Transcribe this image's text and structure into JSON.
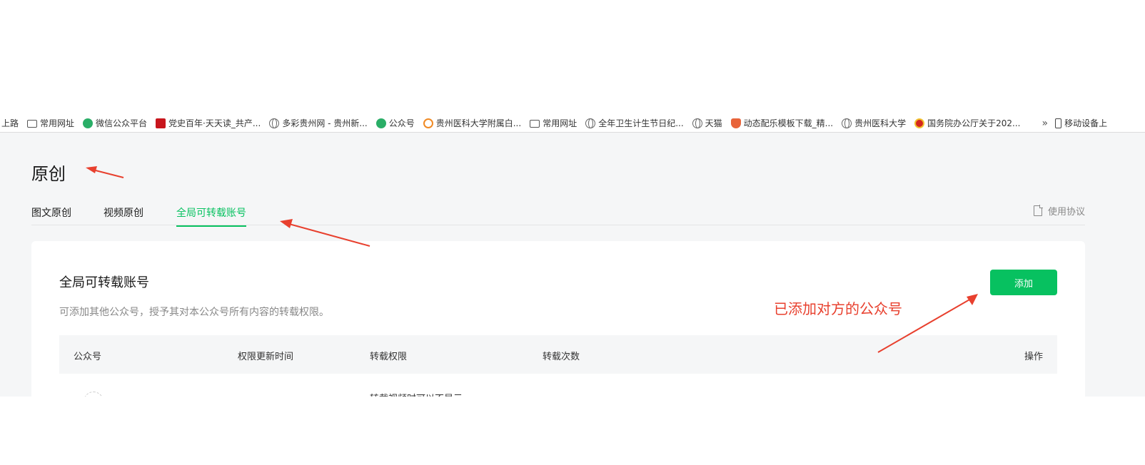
{
  "bookmarks": {
    "items": [
      {
        "label": "上路",
        "icon": "none"
      },
      {
        "label": "常用网址",
        "icon": "folder-icon"
      },
      {
        "label": "微信公众平台",
        "icon": "wechat-icon"
      },
      {
        "label": "党史百年·天天读_共产...",
        "icon": "party-icon"
      },
      {
        "label": "多彩贵州网 - 贵州新...",
        "icon": "globe-icon"
      },
      {
        "label": "公众号",
        "icon": "wechat-icon"
      },
      {
        "label": "贵州医科大学附属白...",
        "icon": "play-circle-icon"
      },
      {
        "label": "常用网址",
        "icon": "folder-icon"
      },
      {
        "label": "全年卫生计生节日纪...",
        "icon": "globe-icon"
      },
      {
        "label": "天猫",
        "icon": "globe-icon"
      },
      {
        "label": "动态配乐模板下载_精...",
        "icon": "fox-icon"
      },
      {
        "label": "贵州医科大学",
        "icon": "globe-icon"
      },
      {
        "label": "国务院办公厅关于202...",
        "icon": "emblem-icon"
      }
    ],
    "more_glyph": "»",
    "mobile_label": "移动设备上"
  },
  "page": {
    "title": "原创",
    "tabs": [
      "图文原创",
      "视频原创",
      "全局可转载账号"
    ],
    "active_tab_index": 2,
    "usage_link": "使用协议"
  },
  "card": {
    "title": "全局可转载账号",
    "description": "可添加其他公众号，授予其对本公众号所有内容的转载权限。",
    "add_button": "添加",
    "table_headers": [
      "公众号",
      "权限更新时间",
      "转载权限",
      "转载次数",
      "操作"
    ],
    "partial_row_text": "转载视频时可以不显示"
  },
  "annotation": {
    "text": "已添加对方的公众号",
    "color": "#e8402e"
  },
  "colors": {
    "accent": "#07c160",
    "page_bg": "#f5f6f7",
    "annotation_red": "#e8402e"
  }
}
